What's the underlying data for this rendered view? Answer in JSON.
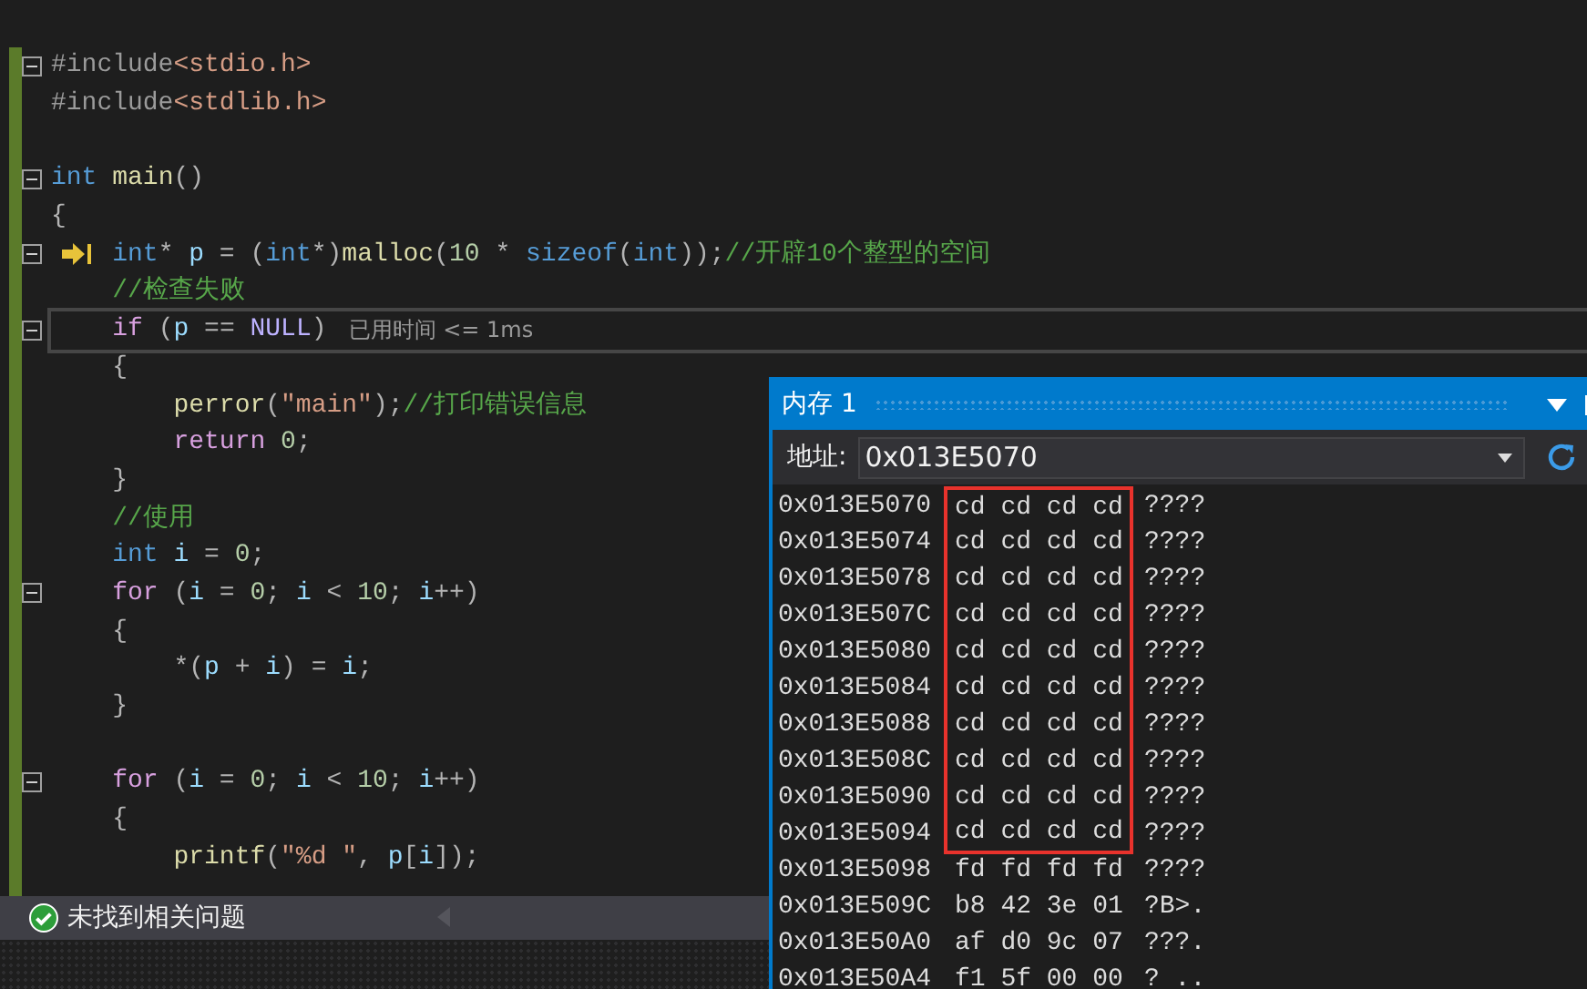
{
  "editor": {
    "lines": [
      {
        "fold": true,
        "pointer": false,
        "cursor": false,
        "tokens": [
          {
            "kind": "directive",
            "text": "#include"
          },
          {
            "kind": "header",
            "text": "<stdio.h>"
          }
        ]
      },
      {
        "fold": false,
        "pointer": false,
        "cursor": false,
        "tokens": [
          {
            "kind": "directive",
            "text": "#include"
          },
          {
            "kind": "header",
            "text": "<stdlib.h>"
          }
        ]
      },
      {
        "fold": false,
        "pointer": false,
        "cursor": false
      },
      {
        "fold": true,
        "pointer": false,
        "cursor": false,
        "tokens": [
          {
            "kind": "keyword",
            "text": "int "
          },
          {
            "kind": "func",
            "text": "main"
          },
          {
            "kind": "punct",
            "text": "()"
          }
        ]
      },
      {
        "fold": false,
        "pointer": false,
        "cursor": false,
        "tokens": [
          {
            "kind": "punct",
            "text": "{"
          }
        ]
      },
      {
        "fold": true,
        "pointer": true,
        "cursor": false,
        "tokens": [
          {
            "kind": "keyword",
            "text": "    int"
          },
          {
            "kind": "punct",
            "text": "* "
          },
          {
            "kind": "var",
            "text": "p"
          },
          {
            "kind": "punct",
            "text": " = ("
          },
          {
            "kind": "keyword",
            "text": "int"
          },
          {
            "kind": "punct",
            "text": "*)"
          },
          {
            "kind": "func",
            "text": "malloc"
          },
          {
            "kind": "punct",
            "text": "("
          },
          {
            "kind": "number",
            "text": "10"
          },
          {
            "kind": "punct",
            "text": " * "
          },
          {
            "kind": "keyword",
            "text": "sizeof"
          },
          {
            "kind": "punct",
            "text": "("
          },
          {
            "kind": "keyword",
            "text": "int"
          },
          {
            "kind": "punct",
            "text": "));"
          },
          {
            "kind": "comment",
            "text": "//开辟10个整型的空间"
          }
        ]
      },
      {
        "fold": false,
        "pointer": false,
        "cursor": false,
        "tokens": [
          {
            "kind": "comment",
            "text": "    //检查失败"
          }
        ]
      },
      {
        "fold": true,
        "pointer": false,
        "cursor": true,
        "tip": "已用时间 <= 1ms",
        "tokens": [
          {
            "kind": "control",
            "text": "    if"
          },
          {
            "kind": "punct",
            "text": " ("
          },
          {
            "kind": "var",
            "text": "p"
          },
          {
            "kind": "punct",
            "text": " == "
          },
          {
            "kind": "macro",
            "text": "NULL"
          },
          {
            "kind": "punct",
            "text": ")"
          }
        ]
      },
      {
        "fold": false,
        "pointer": false,
        "cursor": false,
        "tokens": [
          {
            "kind": "punct",
            "text": "    {"
          }
        ]
      },
      {
        "fold": false,
        "pointer": false,
        "cursor": false,
        "tokens": [
          {
            "kind": "func",
            "text": "        perror"
          },
          {
            "kind": "punct",
            "text": "("
          },
          {
            "kind": "string",
            "text": "\"main\""
          },
          {
            "kind": "punct",
            "text": ");"
          },
          {
            "kind": "comment",
            "text": "//打印错误信息"
          }
        ]
      },
      {
        "fold": false,
        "pointer": false,
        "cursor": false,
        "tokens": [
          {
            "kind": "control",
            "text": "        return "
          },
          {
            "kind": "number",
            "text": "0"
          },
          {
            "kind": "punct",
            "text": ";"
          }
        ]
      },
      {
        "fold": false,
        "pointer": false,
        "cursor": false,
        "tokens": [
          {
            "kind": "punct",
            "text": "    }"
          }
        ]
      },
      {
        "fold": false,
        "pointer": false,
        "cursor": false,
        "tokens": [
          {
            "kind": "comment",
            "text": "    //使用"
          }
        ]
      },
      {
        "fold": false,
        "pointer": false,
        "cursor": false,
        "tokens": [
          {
            "kind": "keyword",
            "text": "    int "
          },
          {
            "kind": "var",
            "text": "i"
          },
          {
            "kind": "punct",
            "text": " = "
          },
          {
            "kind": "number",
            "text": "0"
          },
          {
            "kind": "punct",
            "text": ";"
          }
        ]
      },
      {
        "fold": true,
        "pointer": false,
        "cursor": false,
        "tokens": [
          {
            "kind": "control",
            "text": "    for"
          },
          {
            "kind": "punct",
            "text": " ("
          },
          {
            "kind": "var",
            "text": "i"
          },
          {
            "kind": "punct",
            "text": " = "
          },
          {
            "kind": "number",
            "text": "0"
          },
          {
            "kind": "punct",
            "text": "; "
          },
          {
            "kind": "var",
            "text": "i"
          },
          {
            "kind": "punct",
            "text": " < "
          },
          {
            "kind": "number",
            "text": "10"
          },
          {
            "kind": "punct",
            "text": "; "
          },
          {
            "kind": "var",
            "text": "i"
          },
          {
            "kind": "punct",
            "text": "++)"
          }
        ]
      },
      {
        "fold": false,
        "pointer": false,
        "cursor": false,
        "tokens": [
          {
            "kind": "punct",
            "text": "    {"
          }
        ]
      },
      {
        "fold": false,
        "pointer": false,
        "cursor": false,
        "tokens": [
          {
            "kind": "punct",
            "text": "        *("
          },
          {
            "kind": "var",
            "text": "p"
          },
          {
            "kind": "punct",
            "text": " + "
          },
          {
            "kind": "var",
            "text": "i"
          },
          {
            "kind": "punct",
            "text": ") = "
          },
          {
            "kind": "var",
            "text": "i"
          },
          {
            "kind": "punct",
            "text": ";"
          }
        ]
      },
      {
        "fold": false,
        "pointer": false,
        "cursor": false,
        "tokens": [
          {
            "kind": "punct",
            "text": "    }"
          }
        ]
      },
      {
        "fold": false,
        "pointer": false,
        "cursor": false
      },
      {
        "fold": true,
        "pointer": false,
        "cursor": false,
        "tokens": [
          {
            "kind": "control",
            "text": "    for"
          },
          {
            "kind": "punct",
            "text": " ("
          },
          {
            "kind": "var",
            "text": "i"
          },
          {
            "kind": "punct",
            "text": " = "
          },
          {
            "kind": "number",
            "text": "0"
          },
          {
            "kind": "punct",
            "text": "; "
          },
          {
            "kind": "var",
            "text": "i"
          },
          {
            "kind": "punct",
            "text": " < "
          },
          {
            "kind": "number",
            "text": "10"
          },
          {
            "kind": "punct",
            "text": "; "
          },
          {
            "kind": "var",
            "text": "i"
          },
          {
            "kind": "punct",
            "text": "++)"
          }
        ]
      },
      {
        "fold": false,
        "pointer": false,
        "cursor": false,
        "tokens": [
          {
            "kind": "punct",
            "text": "    {"
          }
        ]
      },
      {
        "fold": false,
        "pointer": false,
        "cursor": false,
        "tokens": [
          {
            "kind": "func",
            "text": "        printf"
          },
          {
            "kind": "punct",
            "text": "("
          },
          {
            "kind": "string",
            "text": "\"%d \""
          },
          {
            "kind": "punct",
            "text": ", "
          },
          {
            "kind": "var",
            "text": "p"
          },
          {
            "kind": "punct",
            "text": "["
          },
          {
            "kind": "var",
            "text": "i"
          },
          {
            "kind": "punct",
            "text": "]);"
          }
        ]
      }
    ]
  },
  "status_bar": {
    "message": "未找到相关问题"
  },
  "memory_window": {
    "title": "内存 1",
    "address_label": "地址:",
    "address": "0x013E5070",
    "rows": [
      {
        "address": "0x013E5070",
        "bytes": "cd cd cd cd",
        "chars": "????",
        "boxed": true
      },
      {
        "address": "0x013E5074",
        "bytes": "cd cd cd cd",
        "chars": "????",
        "boxed": true
      },
      {
        "address": "0x013E5078",
        "bytes": "cd cd cd cd",
        "chars": "????",
        "boxed": true
      },
      {
        "address": "0x013E507C",
        "bytes": "cd cd cd cd",
        "chars": "????",
        "boxed": true
      },
      {
        "address": "0x013E5080",
        "bytes": "cd cd cd cd",
        "chars": "????",
        "boxed": true
      },
      {
        "address": "0x013E5084",
        "bytes": "cd cd cd cd",
        "chars": "????",
        "boxed": true
      },
      {
        "address": "0x013E5088",
        "bytes": "cd cd cd cd",
        "chars": "????",
        "boxed": true
      },
      {
        "address": "0x013E508C",
        "bytes": "cd cd cd cd",
        "chars": "????",
        "boxed": true
      },
      {
        "address": "0x013E5090",
        "bytes": "cd cd cd cd",
        "chars": "????",
        "boxed": true
      },
      {
        "address": "0x013E5094",
        "bytes": "cd cd cd cd",
        "chars": "????",
        "boxed": true
      },
      {
        "address": "0x013E5098",
        "bytes": "fd fd fd fd",
        "chars": "????",
        "boxed": false
      },
      {
        "address": "0x013E509C",
        "bytes": "b8 42 3e 01",
        "chars": "?B>.",
        "boxed": false
      },
      {
        "address": "0x013E50A0",
        "bytes": "af d0 9c 07",
        "chars": "???.",
        "boxed": false
      },
      {
        "address": "0x013E50A4",
        "bytes": "f1 5f 00 00",
        "chars": "? ..",
        "boxed": false
      }
    ]
  }
}
